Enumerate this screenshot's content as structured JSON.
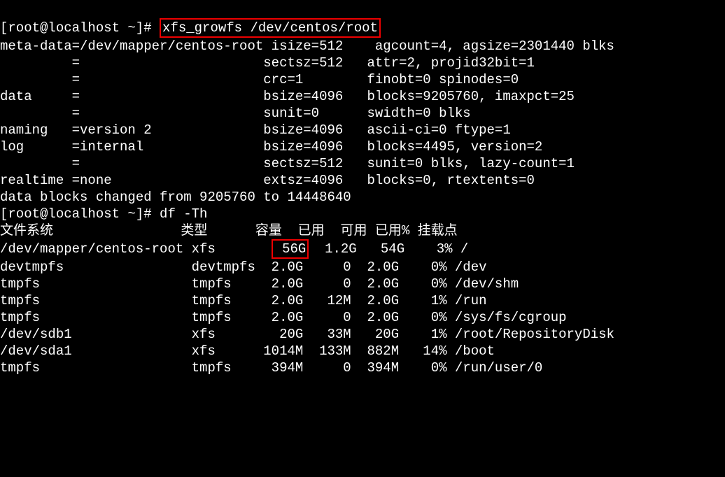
{
  "lines": {
    "0": {
      "prompt": "[root@localhost ~]#",
      "cmd": "xfs_growfs /dev/centos/root"
    },
    "1": "meta-data=/dev/mapper/centos-root isize=512    agcount=4, agsize=2301440 blks",
    "2": "         =                       sectsz=512   attr=2, projid32bit=1",
    "3": "         =                       crc=1        finobt=0 spinodes=0",
    "4": "data     =                       bsize=4096   blocks=9205760, imaxpct=25",
    "5": "         =                       sunit=0      swidth=0 blks",
    "6": "naming   =version 2              bsize=4096   ascii-ci=0 ftype=1",
    "7": "log      =internal               bsize=4096   blocks=4495, version=2",
    "8": "         =                       sectsz=512   sunit=0 blks, lazy-count=1",
    "9": "realtime =none                   extsz=4096   blocks=0, rtextents=0",
    "10": "data blocks changed from 9205760 to 14448640",
    "11": {
      "prompt": "[root@localhost ~]#",
      "cmd": "df -Th"
    }
  },
  "df": {
    "header": "文件系统                类型      容量  已用  可用 已用% 挂载点",
    "rows": {
      "0": {
        "pre": "/dev/mapper/centos-root xfs       ",
        "hl": " 56G",
        "post": "  1.2G   54G    3% /"
      },
      "1": "devtmpfs                devtmpfs  2.0G     0  2.0G    0% /dev",
      "2": "tmpfs                   tmpfs     2.0G     0  2.0G    0% /dev/shm",
      "3": "tmpfs                   tmpfs     2.0G   12M  2.0G    1% /run",
      "4": "tmpfs                   tmpfs     2.0G     0  2.0G    0% /sys/fs/cgroup",
      "5": "/dev/sdb1               xfs        20G   33M   20G    1% /root/RepositoryDisk",
      "6": "/dev/sda1               xfs      1014M  133M  882M   14% /boot",
      "7": "tmpfs                   tmpfs     394M     0  394M    0% /run/user/0"
    }
  }
}
